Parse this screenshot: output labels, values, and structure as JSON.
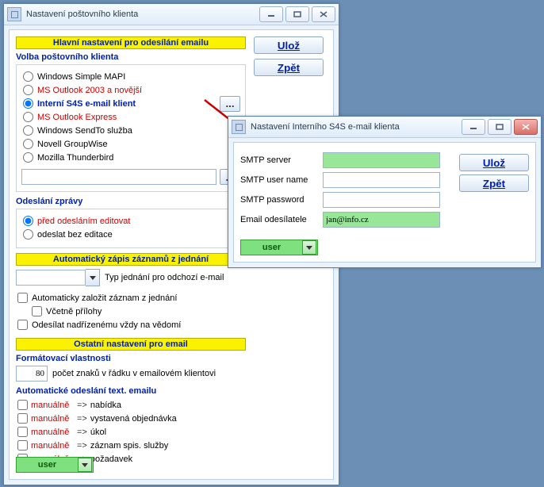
{
  "win1": {
    "title": "Nastavení poštovního klienta",
    "buttons": {
      "save": "Ulož",
      "back": "Zpět"
    },
    "sections": {
      "main_header": "Hlavní nastavení pro odesílání emailu",
      "client_choice": "Volba poštovního klienta",
      "send_msg": "Odeslání zprávy",
      "auto_header": "Automatický zápis záznamů z jednání",
      "other_header": "Ostatní nastavení pro email",
      "format_props": "Formátovací vlastnosti",
      "auto_send": "Automatické odeslání text. emailu"
    },
    "clients": [
      "Windows Simple MAPI",
      "MS Outlook 2003 a novější",
      "Interní S4S e-mail klient",
      "MS Outlook Express",
      "Windows SendTo služba",
      "Novell GroupWise",
      "Mozilla Thunderbird"
    ],
    "client_selected_index": 2,
    "client_red_indices": [
      1,
      3
    ],
    "send_options": [
      "před odesláním editovat",
      "odeslat bez editace"
    ],
    "send_selected_index": 0,
    "type_label": "Typ jednání pro odchozí e-mail",
    "auto_checks": [
      "Automaticky založit záznam z jednání",
      "Včetně přílohy",
      "Odesílat nadřízenému vždy na vědomí"
    ],
    "chars_value": "80",
    "chars_label": "počet znaků v řádku v emailovém klientovi",
    "auto_items": [
      {
        "mode": "manuálně",
        "target": "nabídka"
      },
      {
        "mode": "manuálně",
        "target": "vystavená objednávka"
      },
      {
        "mode": "manuálně",
        "target": "úkol"
      },
      {
        "mode": "manuálně",
        "target": "záznam spis. služby"
      },
      {
        "mode": "manuálně",
        "target": "požadavek"
      }
    ],
    "arrow_sep": "=>",
    "user_btn": "user"
  },
  "win2": {
    "title": "Nastavení Interního S4S e-mail klienta",
    "buttons": {
      "save": "Ulož",
      "back": "Zpět"
    },
    "fields": {
      "smtp_server": {
        "label": "SMTP server",
        "value": ""
      },
      "smtp_user": {
        "label": "SMTP user name",
        "value": ""
      },
      "smtp_pass": {
        "label": "SMTP password",
        "value": ""
      },
      "email_from": {
        "label": "Email odesílatele",
        "value": "jan@info.cz"
      }
    },
    "user_btn": "user"
  }
}
